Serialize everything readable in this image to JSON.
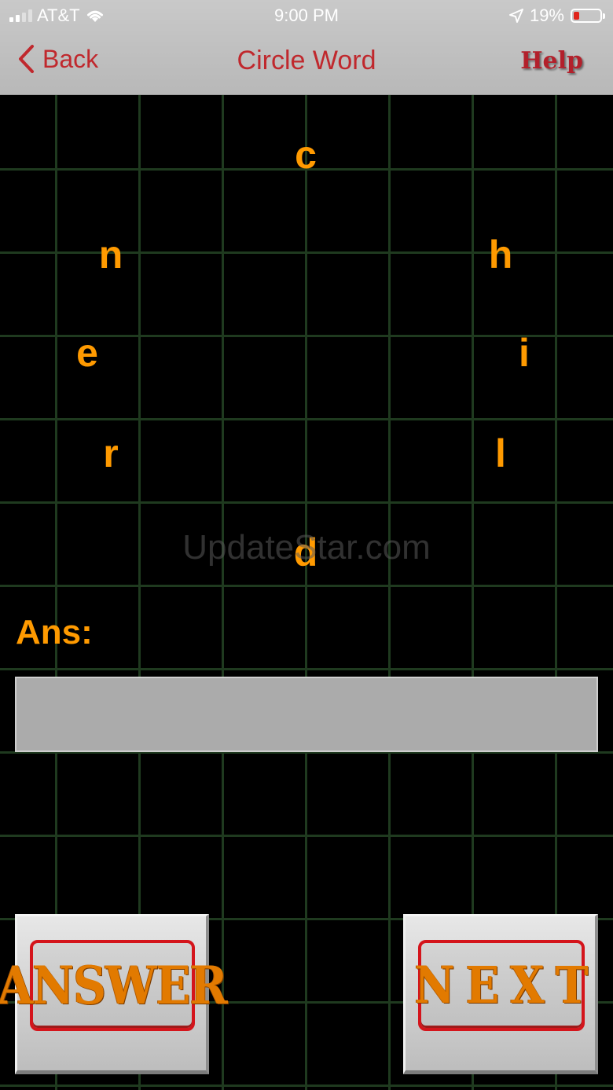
{
  "status_bar": {
    "carrier": "AT&T",
    "time": "9:00 PM",
    "battery": "19%",
    "battery_level": 0.19
  },
  "nav": {
    "back_label": "Back",
    "title": "Circle Word",
    "help_label": "Help"
  },
  "letters": [
    "c",
    "n",
    "h",
    "e",
    "i",
    "r",
    "l",
    "d"
  ],
  "watermark": "UpdateStar.com",
  "answer": {
    "label": "Ans:",
    "value": ""
  },
  "buttons": {
    "answer": "ANSWER",
    "next": "NEXT"
  },
  "colors": {
    "accent": "#c0282d",
    "letter": "#ff9a00",
    "grid": "#1f3a1f",
    "field": "#ababab"
  }
}
